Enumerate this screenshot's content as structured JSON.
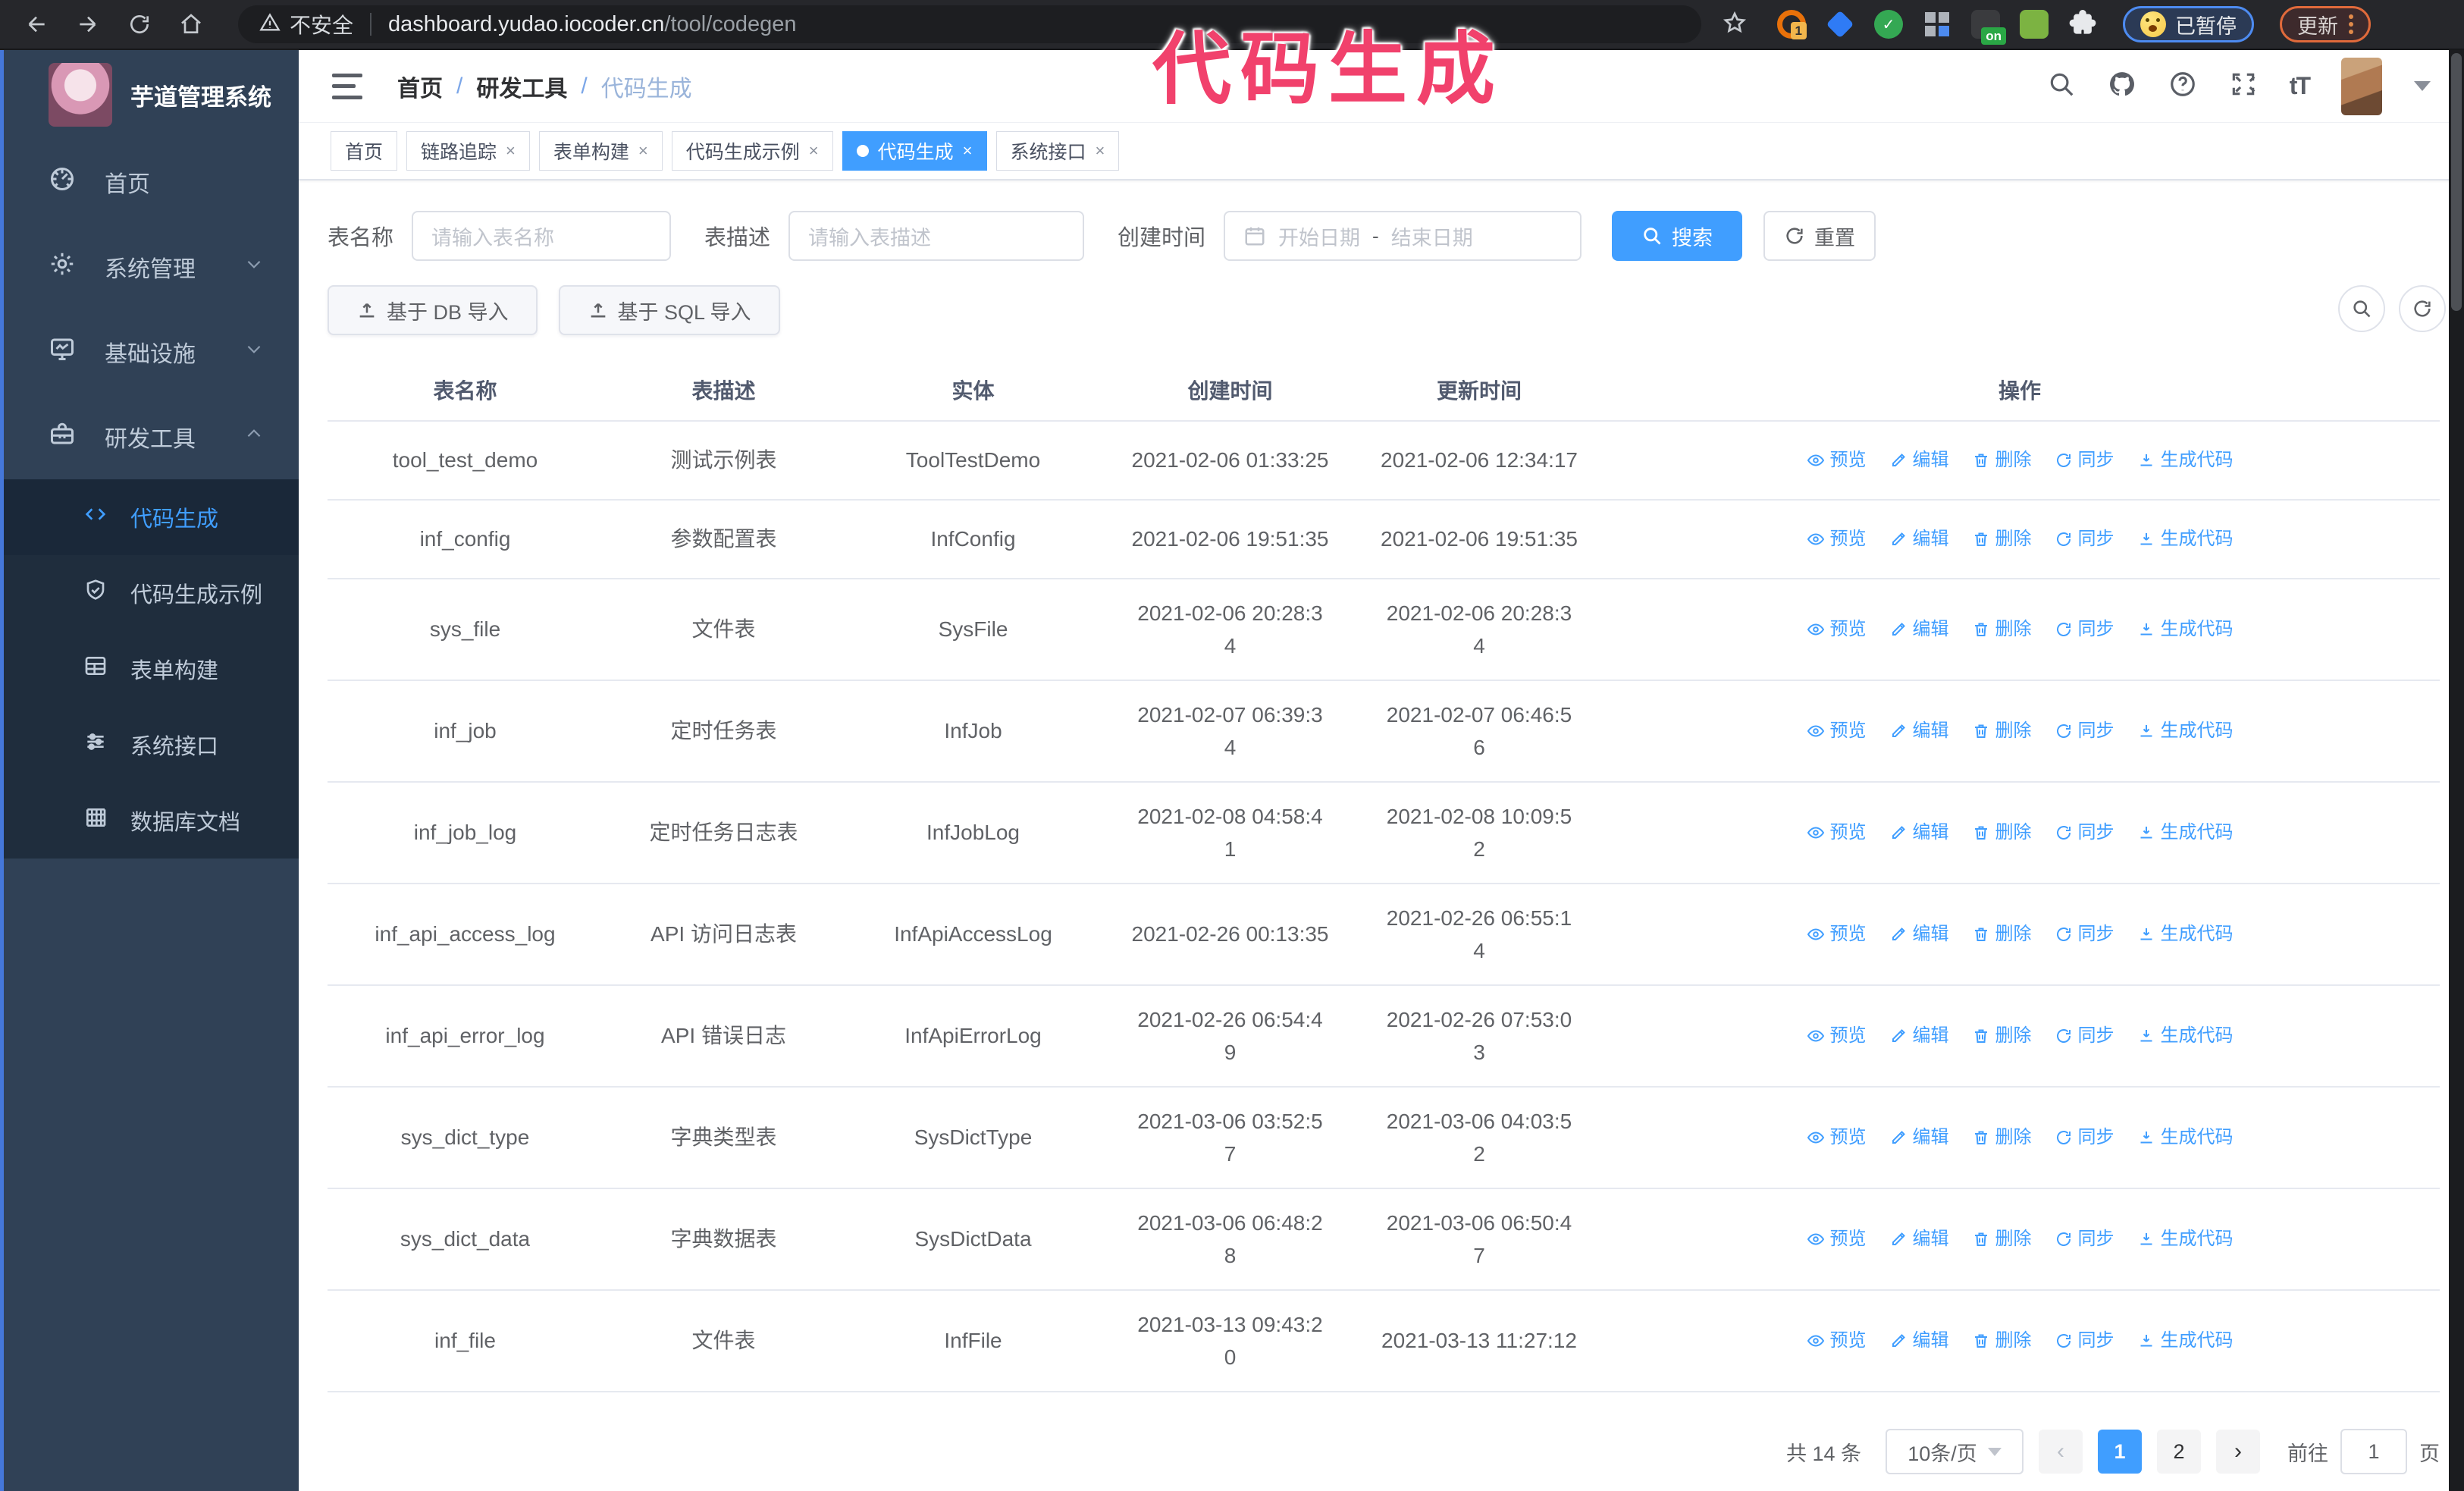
{
  "browser": {
    "security_label": "不安全",
    "url_host": "dashboard.yudao.iocoder.cn",
    "url_path": "/tool/codegen",
    "paused_label": "已暂停",
    "update_label": "更新",
    "extensions": [
      {
        "icon": "ext-orange-ring-icon",
        "color": "#e8710a",
        "badge": "1"
      },
      {
        "icon": "ext-blue-gem-icon",
        "color": "#2f7bf5",
        "badge": ""
      },
      {
        "icon": "ext-green-check-icon",
        "color": "#34a853",
        "badge": ""
      },
      {
        "icon": "ext-grid-icon",
        "color": "#5f6368",
        "badge": ""
      },
      {
        "icon": "ext-on-switch-icon",
        "color": "#3a3b3e",
        "badge": "on"
      },
      {
        "icon": "ext-plant-icon",
        "color": "#7cb342",
        "badge": ""
      },
      {
        "icon": "extensions-puzzle-icon",
        "color": "#ffffff",
        "badge": ""
      }
    ]
  },
  "annotation": {
    "text": "代码生成",
    "color": "#f1416c"
  },
  "sidebar": {
    "logo_title": "芋道管理系统",
    "items": [
      {
        "label": "首页",
        "icon": "dashboard-icon",
        "chevron": ""
      },
      {
        "label": "系统管理",
        "icon": "gear-icon",
        "chevron": "down"
      },
      {
        "label": "基础设施",
        "icon": "monitor-icon",
        "chevron": "down"
      },
      {
        "label": "研发工具",
        "icon": "toolbox-icon",
        "chevron": "up"
      }
    ],
    "submenu": [
      {
        "label": "代码生成",
        "icon": "code-icon",
        "active": true
      },
      {
        "label": "代码生成示例",
        "icon": "shield-check-icon",
        "active": false
      },
      {
        "label": "表单构建",
        "icon": "form-grid-icon",
        "active": false
      },
      {
        "label": "系统接口",
        "icon": "sliders-icon",
        "active": false
      },
      {
        "label": "数据库文档",
        "icon": "database-columns-icon",
        "active": false
      }
    ]
  },
  "header": {
    "breadcrumb": [
      "首页",
      "研发工具",
      "代码生成"
    ],
    "font_size_label": "tT"
  },
  "tabs": [
    {
      "label": "首页",
      "closable": false,
      "active": false
    },
    {
      "label": "链路追踪",
      "closable": true,
      "active": false
    },
    {
      "label": "表单构建",
      "closable": true,
      "active": false
    },
    {
      "label": "代码生成示例",
      "closable": true,
      "active": false
    },
    {
      "label": "代码生成",
      "closable": true,
      "active": true
    },
    {
      "label": "系统接口",
      "closable": true,
      "active": false
    }
  ],
  "filters": {
    "table_name_label": "表名称",
    "table_name_placeholder": "请输入表名称",
    "table_desc_label": "表描述",
    "table_desc_placeholder": "请输入表描述",
    "create_time_label": "创建时间",
    "date_start_placeholder": "开始日期",
    "date_separator": "-",
    "date_end_placeholder": "结束日期",
    "search_label": "搜索",
    "reset_label": "重置"
  },
  "toolbar": {
    "import_db_label": "基于 DB 导入",
    "import_sql_label": "基于 SQL 导入"
  },
  "table": {
    "columns": [
      "表名称",
      "表描述",
      "实体",
      "创建时间",
      "更新时间",
      "操作"
    ],
    "action_labels": [
      "预览",
      "编辑",
      "删除",
      "同步",
      "生成代码"
    ],
    "action_icons": [
      "eye-icon",
      "edit-icon",
      "delete-icon",
      "sync-icon",
      "download-icon"
    ],
    "rows": [
      {
        "name": "tool_test_demo",
        "desc": "测试示例表",
        "entity": "ToolTestDemo",
        "created": "2021-02-06 01:33:25",
        "updated": "2021-02-06 12:34:17",
        "tall": false
      },
      {
        "name": "inf_config",
        "desc": "参数配置表",
        "entity": "InfConfig",
        "created": "2021-02-06 19:51:35",
        "updated": "2021-02-06 19:51:35",
        "tall": false
      },
      {
        "name": "sys_file",
        "desc": "文件表",
        "entity": "SysFile",
        "created": "2021-02-06 20:28:3\n4",
        "updated": "2021-02-06 20:28:3\n4",
        "tall": true
      },
      {
        "name": "inf_job",
        "desc": "定时任务表",
        "entity": "InfJob",
        "created": "2021-02-07 06:39:3\n4",
        "updated": "2021-02-07 06:46:5\n6",
        "tall": true
      },
      {
        "name": "inf_job_log",
        "desc": "定时任务日志表",
        "entity": "InfJobLog",
        "created": "2021-02-08 04:58:4\n1",
        "updated": "2021-02-08 10:09:5\n2",
        "tall": true
      },
      {
        "name": "inf_api_access_log",
        "desc": "API 访问日志表",
        "entity": "InfApiAccessLog",
        "created": "2021-02-26 00:13:35",
        "updated": "2021-02-26 06:55:1\n4",
        "tall": true
      },
      {
        "name": "inf_api_error_log",
        "desc": "API 错误日志",
        "entity": "InfApiErrorLog",
        "created": "2021-02-26 06:54:4\n9",
        "updated": "2021-02-26 07:53:0\n3",
        "tall": true
      },
      {
        "name": "sys_dict_type",
        "desc": "字典类型表",
        "entity": "SysDictType",
        "created": "2021-03-06 03:52:5\n7",
        "updated": "2021-03-06 04:03:5\n2",
        "tall": true
      },
      {
        "name": "sys_dict_data",
        "desc": "字典数据表",
        "entity": "SysDictData",
        "created": "2021-03-06 06:48:2\n8",
        "updated": "2021-03-06 06:50:4\n7",
        "tall": true
      },
      {
        "name": "inf_file",
        "desc": "文件表",
        "entity": "InfFile",
        "created": "2021-03-13 09:43:2\n0",
        "updated": "2021-03-13 11:27:12",
        "tall": true
      }
    ]
  },
  "pagination": {
    "total_label": "共 14 条",
    "page_size_label": "10条/页",
    "prev_label": "‹",
    "next_label": "›",
    "pages": [
      "1",
      "2"
    ],
    "active_page": "1",
    "goto_label": "前往",
    "goto_value": "1",
    "page_suffix_label": "页"
  }
}
